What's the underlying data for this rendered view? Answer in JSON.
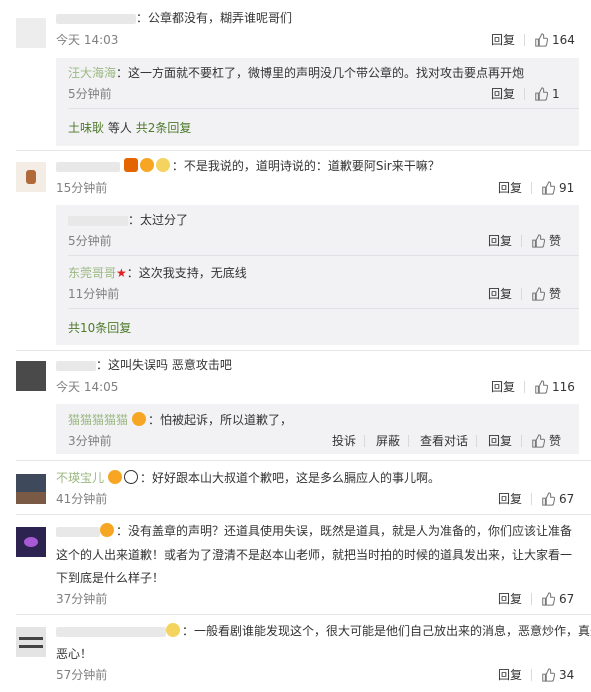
{
  "comments": [
    {
      "text": "：公章都没有，糊弄谁呢哥们",
      "time": "今天 14:03",
      "reply_label": "回复",
      "likes": "164",
      "replies": [
        {
          "name": "汪大海海",
          "text": "：这一方面就不要杠了，微博里的声明没几个带公章的。找对攻击要点再开炮",
          "time": "5分钟前",
          "reply_label": "回复",
          "likes": "1"
        }
      ],
      "more": {
        "who": "土味耿",
        "text": "等人",
        "count": "共2条回复"
      }
    },
    {
      "text": "：不是我说的，道明诗说的：道歉要阿Sir来干嘛？",
      "time": "15分钟前",
      "reply_label": "回复",
      "likes": "91",
      "replies": [
        {
          "text": "：太过分了",
          "time": "5分钟前",
          "reply_label": "回复",
          "likes": "赞"
        },
        {
          "name": "东莞哥哥",
          "text": "：这次我支持，无底线",
          "time": "11分钟前",
          "reply_label": "回复",
          "likes": "赞"
        }
      ],
      "more": {
        "count": "共10条回复"
      }
    },
    {
      "text": "：这叫失误吗 恶意攻击吧",
      "time": "今天 14:05",
      "reply_label": "回复",
      "likes": "116",
      "replies": [
        {
          "name": "猫猫猫猫猫",
          "text": "：怕被起诉，所以道歉了，",
          "time": "3分钟前",
          "report": "投诉",
          "block": "屏蔽",
          "conversation": "查看对话",
          "reply_label": "回复",
          "likes": "赞"
        }
      ]
    },
    {
      "name": "不瑛宝儿",
      "text": "：好好跟本山大叔道个歉吧，这是多么膈应人的事儿啊。",
      "time": "41分钟前",
      "reply_label": "回复",
      "likes": "67"
    },
    {
      "text_lines": [
        "：没有盖章的声明？还道具使用失误，既然是道具，就是人为准备的，你们应该让准备",
        "这个的人出来道歉！或者为了澄清不是赵本山老师，就把当时拍的时候的道具发出来，让大家看一",
        "下到底是什么样子！"
      ],
      "time": "37分钟前",
      "reply_label": "回复",
      "likes": "67"
    },
    {
      "text_lines": [
        "：一般看剧谁能发现这个，很大可能是他们自己放出来的消息，恶意炒作，真是",
        "恶心！"
      ],
      "time": "57分钟前",
      "reply_label": "回复",
      "likes": "34"
    }
  ],
  "colors": {
    "link": "#eb7350",
    "muted": "#808080",
    "reply_bg": "#f2f2f5",
    "green": "#4e7a2a"
  }
}
